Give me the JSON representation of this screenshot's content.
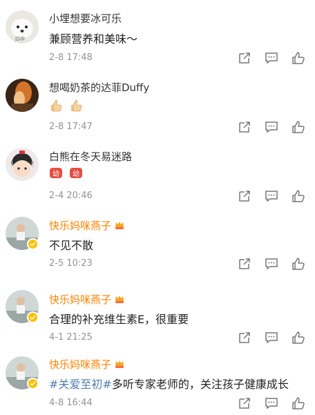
{
  "comments": [
    {
      "user": "小埋想要冰可乐",
      "text": "兼顾营养和美味～",
      "time": "2-8 17:48",
      "avatar_label": "四甲"
    },
    {
      "user": "想喝奶茶的达菲Duffy",
      "text": "",
      "emoji": [
        "thumbs-up-emoji",
        "thumbs-up-emoji"
      ],
      "time": "2-8 17:47"
    },
    {
      "user": "白熊在冬天易迷路",
      "text": "",
      "emoji": [
        "jiayou-emoji",
        "jiayou-emoji"
      ],
      "emoji_label": "幼",
      "time": "2-4 20:46"
    },
    {
      "user": "快乐妈咪燕子",
      "text": "不见不散",
      "time": "2-5 10:23",
      "verified": true
    },
    {
      "user": "快乐妈咪燕子",
      "text": "合理的补充维生素E，很重要",
      "time": "4-1 21:25",
      "verified": true
    },
    {
      "user": "快乐妈咪燕子",
      "topic": "#关爱至初#",
      "text": "多听专家老师的，关注孩子健康成长",
      "time": "4-8 16:44",
      "verified": true
    }
  ],
  "colors": {
    "accent": "#ff8200",
    "topic": "#507daf",
    "meta": "#939393"
  }
}
